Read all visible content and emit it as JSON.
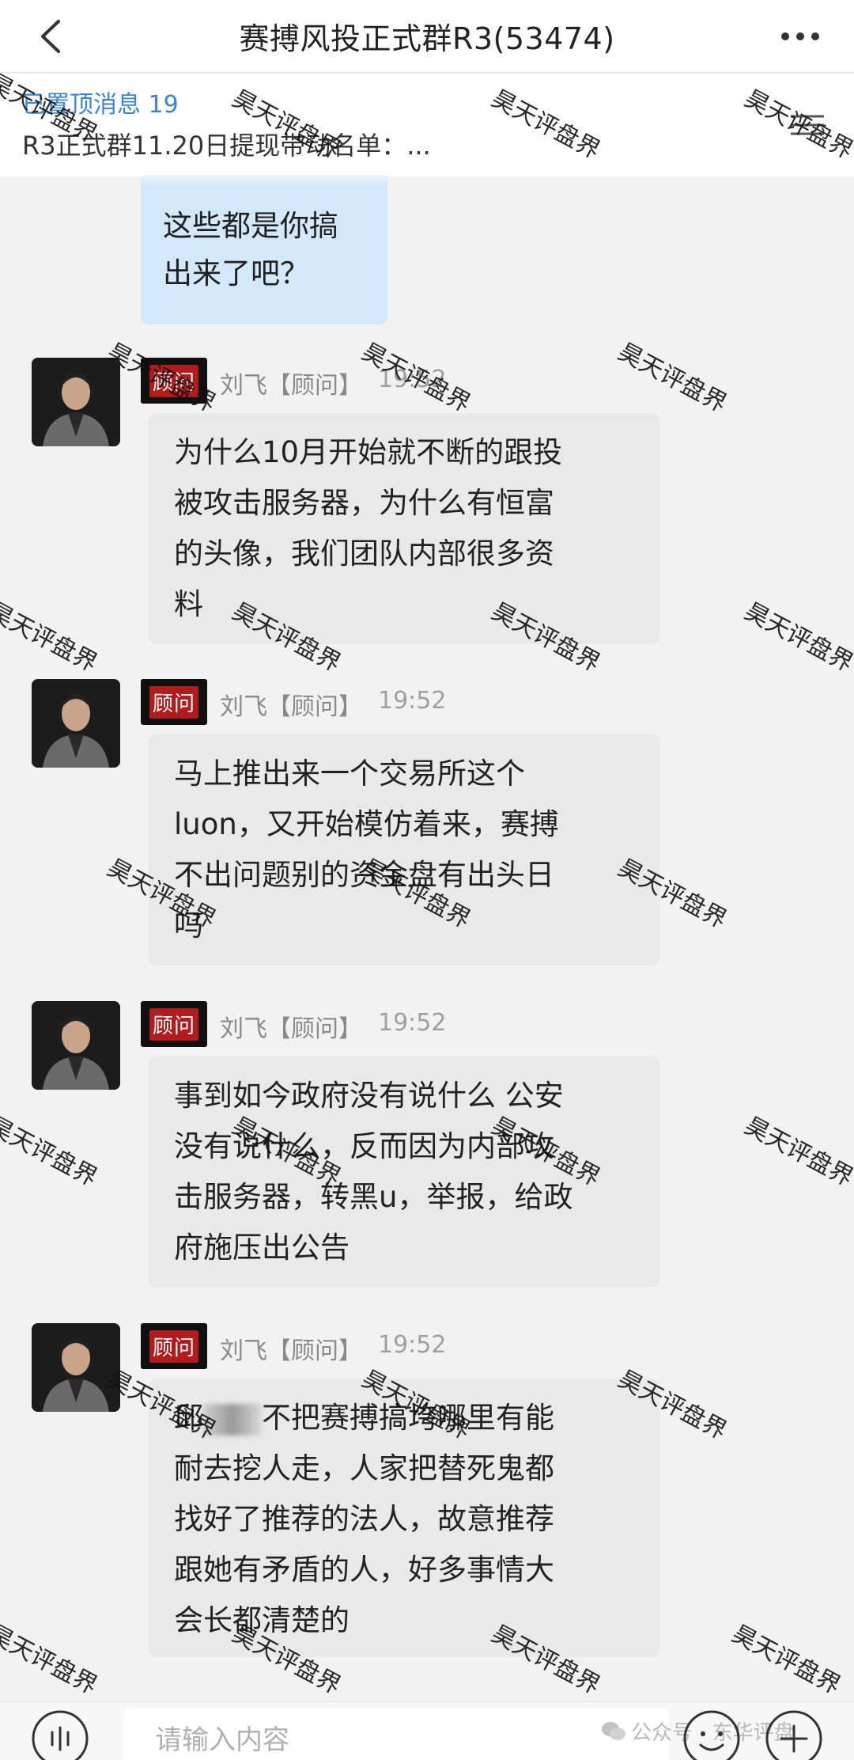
{
  "header": {
    "title": "赛搏风投正式群R3(53474)"
  },
  "pinned": {
    "count_label": "已置顶消息 19",
    "preview": "R3正式群11.20日提现带动名单：..."
  },
  "my_message": {
    "lines": [
      "这些都是你搞",
      "出来了吧？"
    ]
  },
  "messages": [
    {
      "badge": "顾问",
      "sender": "刘飞【顾问】",
      "time": "19:52",
      "lines": [
        "为什么10月开始就不断的跟投",
        "被攻击服务器，为什么有恒富",
        "的头像，我们团队内部很多资",
        "料"
      ]
    },
    {
      "badge": "顾问",
      "sender": "刘飞【顾问】",
      "time": "19:52",
      "lines": [
        "马上推出来一个交易所这个",
        "luon，又开始模仿着来，赛搏",
        "不出问题别的资金盘有出头日",
        "吗"
      ]
    },
    {
      "badge": "顾问",
      "sender": "刘飞【顾问】",
      "time": "19:52",
      "lines": [
        "事到如今政府没有说什么 公安",
        "没有说什么，反而因为内部攻",
        "击服务器，转黑u，举报，给政",
        "府施压出公告"
      ]
    },
    {
      "badge": "顾问",
      "sender": "刘飞【顾问】",
      "time": "19:52",
      "line1_prefix": "邱",
      "line1_suffix": "不把赛搏搞垮哪里有能",
      "lines": [
        "耐去挖人走，人家把替死鬼都",
        "找好了推荐的法人，故意推荐",
        "跟她有矛盾的人，好多事情大",
        "会长都清楚的"
      ]
    }
  ],
  "watermark": "昊天评盘界",
  "input": {
    "placeholder": "请输入内容"
  },
  "source_mark": "公众号 · 东华评盘",
  "colors": {
    "pinned_blue": "#3a84d6",
    "my_bubble": "#d3e8fb",
    "other_bubble": "#e9e9e9",
    "badge_red": "#b21b1b"
  }
}
